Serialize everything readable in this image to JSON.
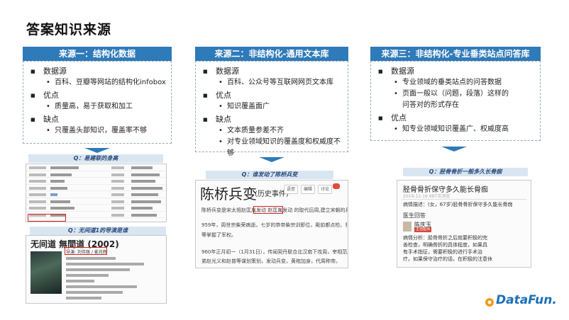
{
  "title": "答案知识来源",
  "columns": [
    {
      "header": "来源一：结构化数据",
      "items": [
        {
          "label": "数据源",
          "subs": [
            "百科、豆瓣等网站的结构化infobox"
          ]
        },
        {
          "label": "优点",
          "subs": [
            "质量高，易于获取和加工"
          ]
        },
        {
          "label": "缺点",
          "subs": [
            "只覆盖头部知识，覆盖率不够"
          ]
        }
      ]
    },
    {
      "header": "来源二：非结构化-通用文本库",
      "items": [
        {
          "label": "数据源",
          "subs": [
            "百科、公众号等互联网网页文本库"
          ]
        },
        {
          "label": "优点",
          "subs": [
            "知识覆盖面广"
          ]
        },
        {
          "label": "缺点",
          "subs": [
            "文本质量参差不齐",
            "对专业领域知识的覆盖度和权威度不够"
          ]
        }
      ]
    },
    {
      "header": "来源三：非结构化-专业垂类站点问答库",
      "items": [
        {
          "label": "数据源",
          "subs": [
            "专业领域的垂类站点的问答数据",
            "页面一般以（问题，段落）这样的问答对的形式存在"
          ]
        },
        {
          "label": "优点",
          "subs": [
            "知专业领域知识覆盖广、权威度高"
          ]
        }
      ]
    }
  ],
  "examples": {
    "q1": "Q：易建联的身高",
    "q2": "Q：无间道1的导演是谁",
    "q3": "Q：谁发动了陈桥兵变",
    "q4": "Q：胫骨骨折一般多久长骨痂",
    "movie_title": "无间道 無間道 (2002)",
    "movie_director_label": "导演: 刘伟强 / 麦兆辉",
    "hist_title": "陈桥兵变",
    "hist_sub": "(历史事件)",
    "hist_buttons": [
      "语音",
      "编辑",
      "讨论"
    ],
    "hist_line1": "陈桥兵变是宋太祖赵匡胤发动 赵匡胤发动 的取代后周,建立宋朝的兵变事件",
    "hist_line2": "959年，周世宗柴荣病逝，七岁的恭帝柴宗训即位，殿前都点检、归德军节度",
    "hist_line3": "等掌握了军权。",
    "hist_line4": "960年正月初一（1月31日），传闻契丹联合北汉南下攻周，宰相范质等人",
    "hist_line5": "弟赵光义和赵普等谋划策划，发动兵变，黄袍加身，代周称帝。",
    "med_title": "胫骨骨折保守多久能长骨痂",
    "med_meta": "2019-12-16    987次浏览",
    "med_q": "病情描述：(女，67岁)胫骨骨折保守多久能长骨痂",
    "med_section": "医生回答",
    "med_doctor": "陈庆玉",
    "med_badge": "主治医师",
    "med_a": [
      "病情分析：胫骨骨折之后就要积极的完",
      "善检查，明确骨折的具体程度，如果具",
      "有手术指征，需要积极的进行手术治",
      "疗。如果保守治疗的话，在积极的注意休",
      "息就可以了。需要积极的进行石膏固",
      "定，一般来讲也需要六周左右的时间才",
      "能够生长出明显的骨痂。"
    ],
    "logo": "DataFun."
  },
  "colors": {
    "header_blue": "#2f7ab8",
    "highlight_red": "#e02020",
    "label_bg": "#d9e6f2"
  }
}
